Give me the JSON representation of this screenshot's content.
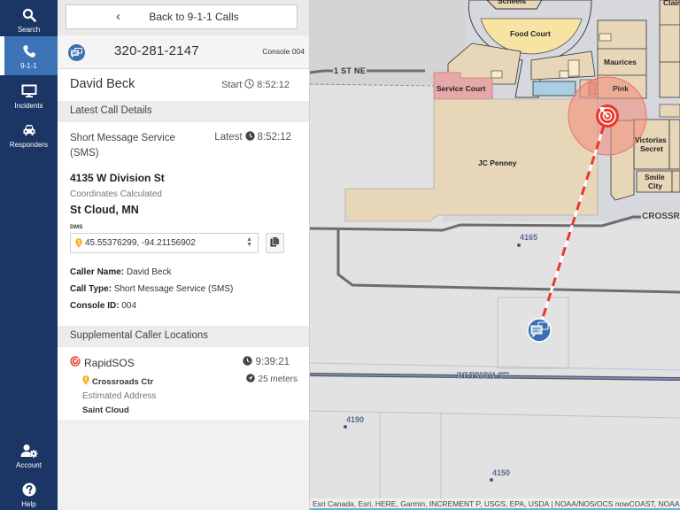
{
  "nav": {
    "items": [
      {
        "label": "Search",
        "icon": "search-icon"
      },
      {
        "label": "9-1-1",
        "icon": "phone-icon",
        "active": true
      },
      {
        "label": "Incidents",
        "icon": "monitor-icon"
      },
      {
        "label": "Responders",
        "icon": "car-icon"
      }
    ],
    "bottom": [
      {
        "label": "Account",
        "icon": "account-settings-icon"
      },
      {
        "label": "Help",
        "icon": "help-icon"
      }
    ]
  },
  "panel": {
    "back_label": "Back to 9-1-1 Calls",
    "call": {
      "phone": "320-281-2147",
      "console": "Console 004",
      "caller_name": "David Beck",
      "start_label": "Start",
      "start_time": "8:52:12"
    },
    "latest_section_title": "Latest Call Details",
    "details": {
      "service": "Short Message Service (SMS)",
      "latest_label": "Latest",
      "latest_time": "8:52:12",
      "address": "4135 W Division St",
      "coordinates_status": "Coordinates Calculated",
      "city": "St Cloud, MN",
      "format_label": "DMS",
      "coordinates": "45.55376299, -94.21156902",
      "fields": [
        {
          "key": "Caller Name:",
          "value": "David Beck"
        },
        {
          "key": "Call Type:",
          "value": "Short Message Service (SMS)"
        },
        {
          "key": "Console ID:",
          "value": "004"
        }
      ]
    },
    "supplemental_section_title": "Supplemental Caller Locations",
    "supplemental": {
      "source": "RapidSOS",
      "time": "9:39:21",
      "location_name": "Crossroads Ctr",
      "address_type": "Estimated Address",
      "city": "Saint Cloud",
      "accuracy": "25 meters"
    }
  },
  "map": {
    "labels": {
      "scheels": "Scheels",
      "claire": "Clair",
      "food_court": "Food Court",
      "maurices": "Maurices",
      "street_1st": "1 ST NE",
      "service_court": "Service Court",
      "pink": "Pink",
      "jc_penney": "JC Penney",
      "victorias_1": "Victorias",
      "victorias_2": "Secret",
      "smile_1": "Smile",
      "smile_2": "City",
      "crossroads": "CROSSR",
      "division_st": "DIVISION ST",
      "addr_4165": "4165",
      "addr_4190": "4190",
      "addr_4150": "4150"
    },
    "attribution": "Esri Canada, Esri, HERE, Garmin, INCREMENT P, USGS, EPA, USDA | NOAA/NOS/OCS nowCOAST, NOAA",
    "colors": {
      "accuracy_circle": "#f08a78",
      "marker_red": "#e8392b",
      "sms_marker": "#3a6fb0"
    }
  }
}
